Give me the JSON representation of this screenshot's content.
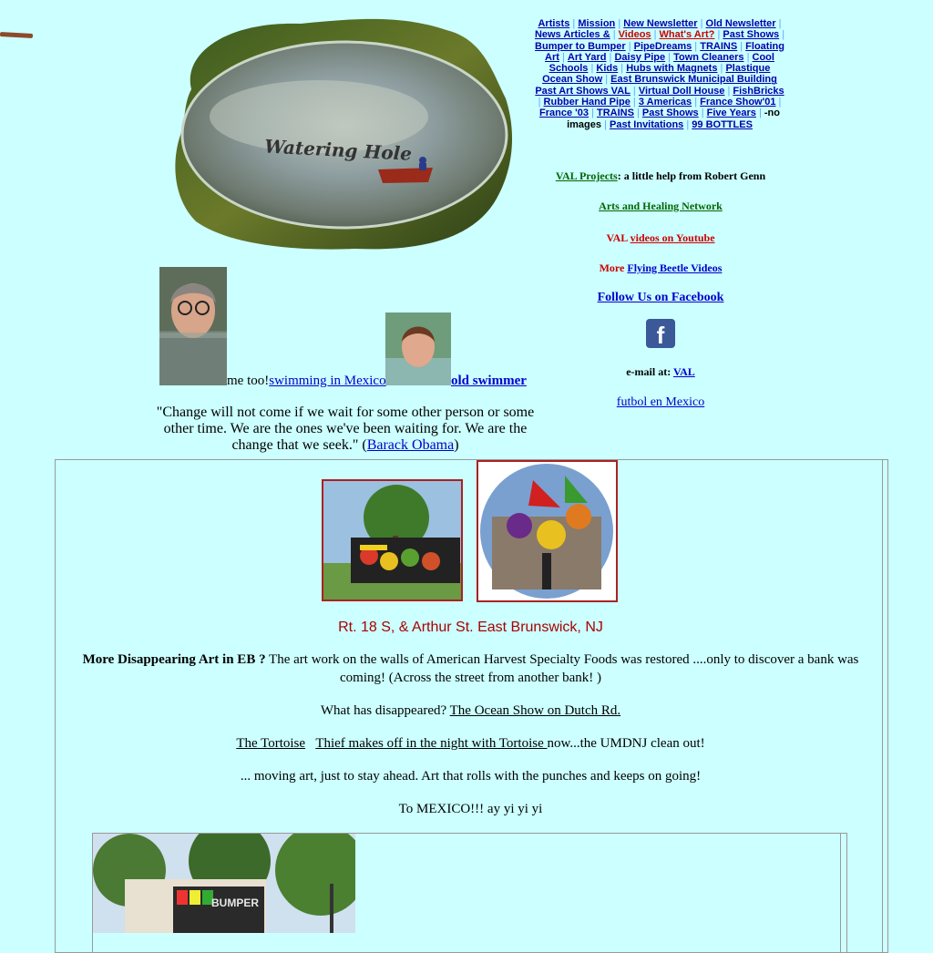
{
  "logo": {
    "text": "Watering Hole"
  },
  "nav": {
    "items": [
      {
        "label": "Artists",
        "red": false
      },
      {
        "label": "Mission",
        "red": false
      },
      {
        "label": "New Newsletter",
        "red": false
      },
      {
        "label": "Old Newsletter",
        "red": false
      },
      {
        "label": "News Articles &",
        "red": false
      },
      {
        "label": "Videos",
        "red": true
      },
      {
        "label": "What's Art?",
        "red": true
      },
      {
        "label": "Past Shows",
        "red": false
      },
      {
        "label": "Bumper to Bumper",
        "red": false
      },
      {
        "label": "PipeDreams",
        "red": false
      },
      {
        "label": "TRAINS",
        "red": false
      },
      {
        "label": "Floating Art",
        "red": false
      },
      {
        "label": "Art Yard",
        "red": false
      },
      {
        "label": "Daisy Pipe",
        "red": false
      },
      {
        "label": "Town Cleaners",
        "red": false
      },
      {
        "label": "Cool Schools",
        "red": false
      },
      {
        "label": "Kids",
        "red": false
      },
      {
        "label": "Hubs with Magnets",
        "red": false
      },
      {
        "label": "Plastique Ocean Show",
        "red": false
      },
      {
        "label": "East  Brunswick Municipal Building Past Art Shows VAL",
        "red": false
      },
      {
        "label": "Virtual Doll House",
        "red": false
      },
      {
        "label": "FishBricks",
        "red": false
      },
      {
        "label": "Rubber Hand Pipe",
        "red": false
      },
      {
        "label": "3 Americas",
        "red": false
      },
      {
        "label": "France Show'01",
        "red": false
      },
      {
        "label": "France '03",
        "red": false
      },
      {
        "label": "TRAINS",
        "red": false
      },
      {
        "label": "Past Shows",
        "red": false
      },
      {
        "label": "Five Years",
        "red": false
      }
    ],
    "no_images_text": "-no images",
    "past_invitations": "Past Invitations",
    "bottles": "99 BOTTLES"
  },
  "side": {
    "val_projects_link": "VAL Projects",
    "val_projects_text": ": a little help from Robert Genn",
    "arts_healing": "Arts and Healing Network",
    "val_prefix": "VAL ",
    "videos_youtube": "videos on Youtube",
    "more_prefix": "More ",
    "flying_beetle": "Flying Beetle Videos",
    "follow_facebook": "Follow Us on Facebook",
    "email_prefix": "e-mail at: ",
    "email_link": "VAL",
    "futbol": "futbol en Mexico"
  },
  "swim": {
    "me_too": "me too!",
    "swimming_link": "swimming in Mexico",
    "old_swimmer": "old swimmer"
  },
  "quote": {
    "text": "\"Change will not come if we wait for some other person or some other time. We are the ones we've been waiting for. We are the change that we seek.\" (",
    "author_link": "Barack Obama",
    "close": ")"
  },
  "main": {
    "caption": "Rt. 18 S, & Arthur St. East Brunswick, NJ",
    "p1_bold": "More Disappearing Art in EB ?",
    "p1_text": " The art work on the walls of American Harvest Specialty Foods was restored ....only to discover a bank was coming! (Across the street from another bank! )",
    "p2_text": "What has disappeared? ",
    "p2_link": "The Ocean Show on Dutch Rd.",
    "p3_link1": "The Tortoise",
    "p3_link2": "Thief makes off in the night with Tortoise   ",
    "p3_text": "now...the UMDNJ clean out!",
    "p4_text": "... moving art, just to stay ahead. Art that rolls with the punches and keeps on going!",
    "p5_text": "To MEXICO!!! ay yi yi yi"
  },
  "truck": {
    "sign": "BUMPER"
  },
  "colors": {
    "background": "#ccffff",
    "link": "#0000cc",
    "accent_red": "#cc0000",
    "green": "#006600"
  }
}
